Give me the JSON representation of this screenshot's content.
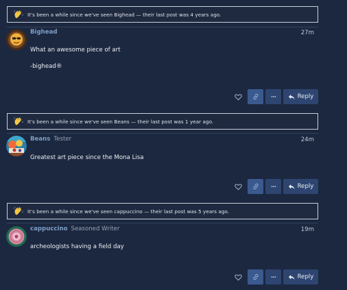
{
  "posts": [
    {
      "notice": "It's been a while since we've seen Bighead — their last post was 4 years ago.",
      "username": "Bighead",
      "user_title": "",
      "time": "27m",
      "lines": [
        "What an awesome piece of art",
        "-bighead®"
      ],
      "reply_label": "Reply"
    },
    {
      "notice": "It's been a while since we've seen Beans — their last post was 1 year ago.",
      "username": "Beans",
      "user_title": "Tester",
      "time": "24m",
      "lines": [
        "Greatest art piece since the Mona Lisa"
      ],
      "reply_label": "Reply"
    },
    {
      "notice": "It's been a while since we've seen cappuccino — their last post was 5 years ago.",
      "username": "cappuccino",
      "user_title": "Seasoned Writer",
      "time": "19m",
      "lines": [
        "archeologists having a field day"
      ],
      "reply_label": "Reply"
    }
  ],
  "icons": {
    "notice": "waving-hand-icon",
    "like": "heart-icon",
    "copy_link": "link-icon",
    "more": "ellipsis-icon",
    "reply": "reply-icon"
  },
  "colors": {
    "background": "#1c2840",
    "username": "#7e9ec5",
    "button": "#2d4570",
    "button_active": "#3a5a8f",
    "notice_border": "#c9d1dc"
  }
}
